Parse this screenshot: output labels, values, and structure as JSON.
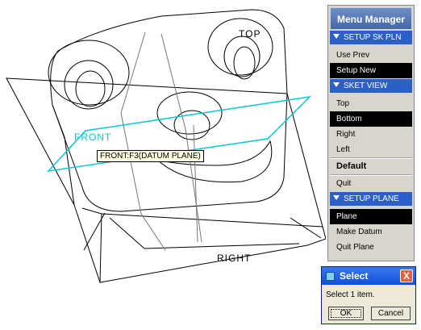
{
  "viewport": {
    "labels": {
      "top": "TOP",
      "right": "RIGHT",
      "front": "FRONT"
    },
    "tooltip": "FRONT:F3(DATUM PLANE)",
    "colors": {
      "datum_highlight": "#00c8d8",
      "model_edges": "#000000"
    }
  },
  "menu_manager": {
    "title": "Menu Manager",
    "sections": [
      {
        "header": "SETUP SK PLN",
        "items": [
          {
            "label": "Use Prev"
          },
          {
            "label": "Setup New",
            "selected": true
          }
        ]
      },
      {
        "header": "SKET VIEW",
        "items": [
          {
            "label": "Top"
          },
          {
            "label": "Bottom",
            "selected": true
          },
          {
            "label": "Right"
          },
          {
            "label": "Left"
          },
          {
            "label": "Default",
            "bold": true
          },
          {
            "label": "Quit"
          }
        ]
      },
      {
        "header": "SETUP PLANE",
        "items": [
          {
            "label": "Plane",
            "selected": true
          },
          {
            "label": "Make Datum"
          },
          {
            "label": "Quit Plane"
          }
        ]
      }
    ],
    "colors": {
      "title_bar": "#4367a8",
      "section_header": "#2b60c8",
      "selected_bg": "#000000"
    }
  },
  "select_dialog": {
    "title": "Select",
    "close_glyph": "X",
    "message": "Select 1 item.",
    "ok_label": "OK",
    "cancel_label": "Cancel"
  }
}
